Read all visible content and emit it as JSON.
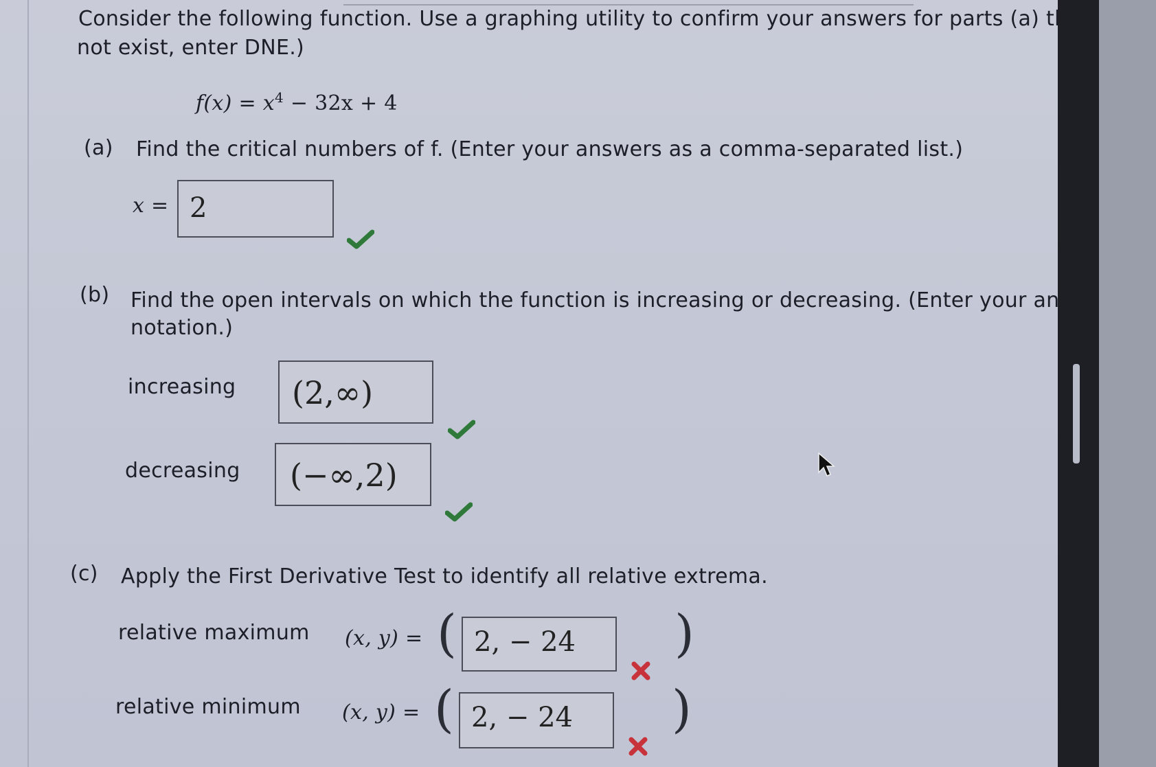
{
  "question": {
    "intro_line1": "Consider the following function. Use a graphing utility to confirm your answers for parts (a) throug",
    "intro_line2": "not exist, enter DNE.)",
    "function": {
      "lhs": "f(x) = x",
      "exponent": "4",
      "rhs": " − 32x + 4"
    }
  },
  "part_a": {
    "letter": "(a)",
    "prompt": "Find the critical numbers of f. (Enter your answers as a comma-separated list.)",
    "x_label": "x =",
    "answer": "2",
    "status": "correct"
  },
  "part_b": {
    "letter": "(b)",
    "prompt_line1": "Find the open intervals on which the function is increasing or decreasing. (Enter your answe",
    "prompt_line2": "notation.)",
    "increasing_label": "increasing",
    "increasing_answer": "(2,∞)",
    "decreasing_label": "decreasing",
    "decreasing_answer": "(−∞,2)",
    "status": "correct"
  },
  "part_c": {
    "letter": "(c)",
    "prompt": "Apply the First Derivative Test to identify all relative extrema.",
    "rel_max_label": "relative maximum",
    "rel_min_label": "relative minimum",
    "xy_label": "(x, y) =",
    "open_paren": "(",
    "close_paren": ")",
    "rel_max_answer": "2, − 24",
    "rel_min_answer": "2, − 24",
    "status": "incorrect"
  },
  "icons": {
    "correct": "check-icon",
    "incorrect": "x-icon",
    "pointer": "cursor-icon"
  },
  "colors": {
    "correct": "#2f7a3a",
    "incorrect": "#c8323a"
  }
}
